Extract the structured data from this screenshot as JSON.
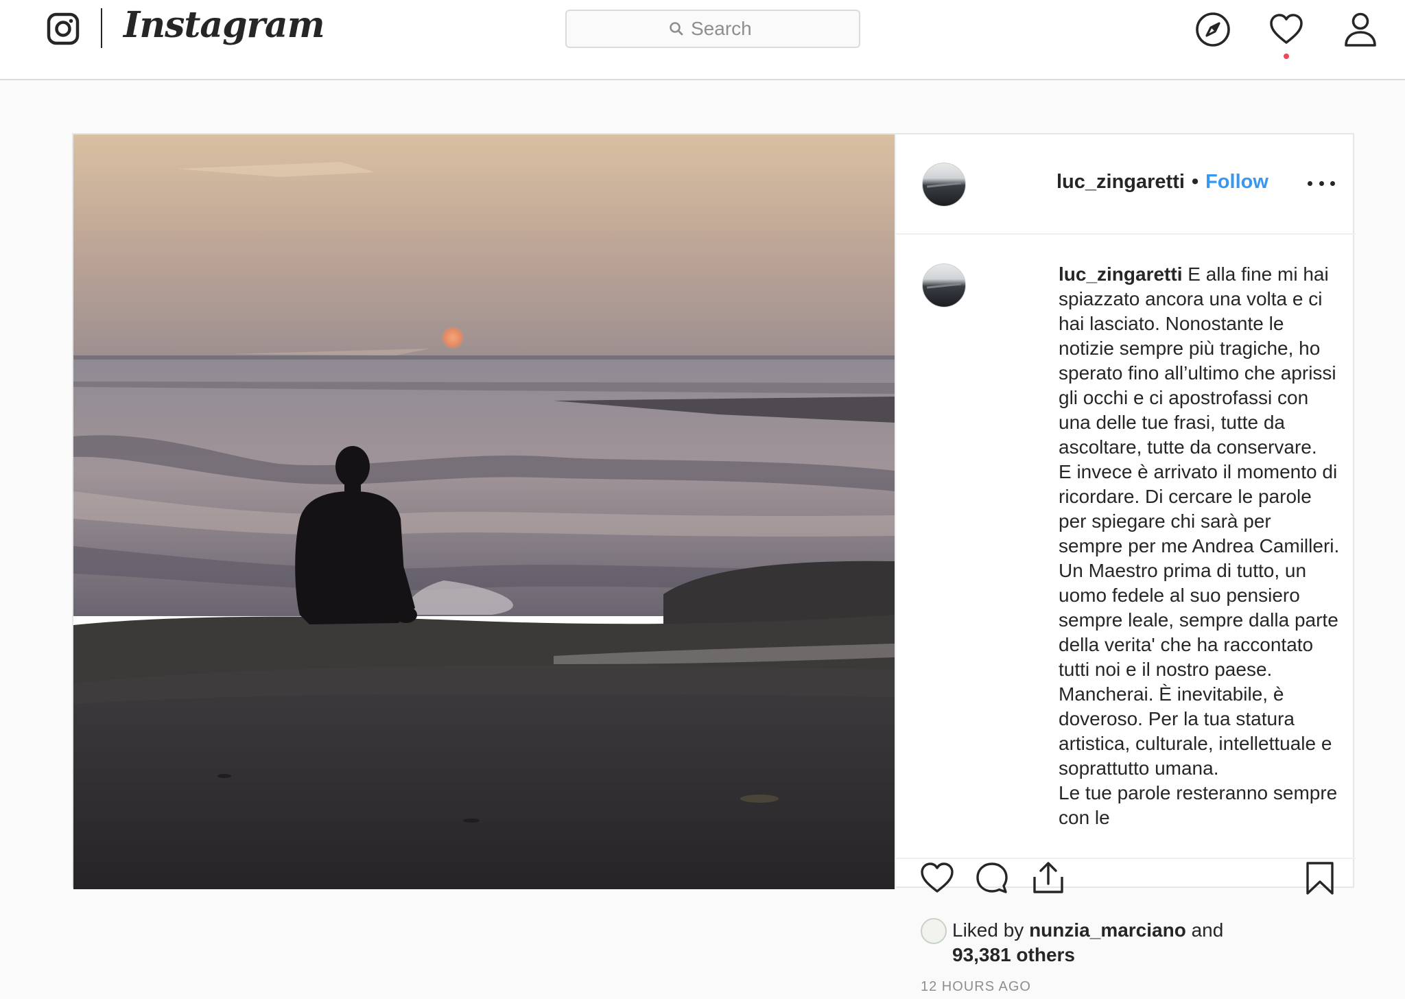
{
  "nav": {
    "wordmark": "Instagram",
    "search_placeholder": "Search"
  },
  "post": {
    "username": "luc_zingaretti",
    "follow_label": "Follow",
    "separator": "•",
    "caption_lines": [
      "E alla fine mi hai spiazzato ancora una volta e ci hai lasciato. Nonostante le notizie sempre più tragiche, ho sperato fino all’ultimo che aprissi gli occhi e ci apostrofassi con una delle tue frasi, tutte da ascoltare, tutte da conservare.",
      "E invece è arrivato il momento di ricordare. Di cercare le parole per spiegare chi sarà per sempre per me Andrea Camilleri. Un Maestro prima di tutto, un uomo fedele al suo pensiero sempre leale, sempre dalla parte della verita' che ha raccontato tutti noi e il nostro paese.",
      "Mancherai. È inevitabile, è doveroso. Per la tua statura artistica, culturale, intellettuale e soprattutto umana.",
      "Le tue parole resteranno sempre con le"
    ],
    "liked_by_prefix": "Liked by",
    "liked_by_user": "nunzia_marciano",
    "liked_by_and": "and",
    "others": "93,381 others",
    "timestamp": "12 HOURS AGO"
  },
  "icons": {
    "camera": "instagram-camera-icon",
    "search": "search-icon",
    "explore": "compass-icon",
    "activity": "heart-icon",
    "profile": "person-icon",
    "more": "more-options-icon",
    "like": "heart-outline-icon",
    "comment": "comment-bubble-icon",
    "share": "share-icon",
    "save": "bookmark-icon"
  },
  "colors": {
    "link_blue": "#3897f0",
    "notification_red": "#ed4956",
    "text": "#262626",
    "muted": "#8e8e8e"
  }
}
